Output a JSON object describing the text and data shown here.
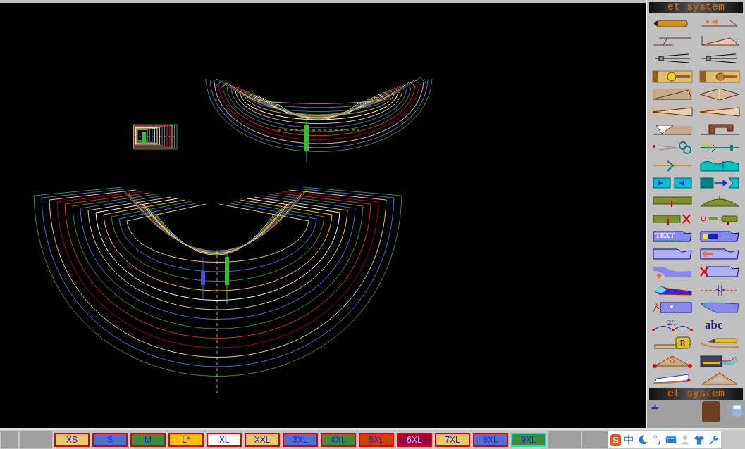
{
  "panel": {
    "header": "et system",
    "tools": [
      {
        "kind": "pencil"
      },
      {
        "kind": "arrow-line"
      },
      {
        "kind": "angle-line"
      },
      {
        "kind": "angle-wedge"
      },
      {
        "kind": "compass"
      },
      {
        "kind": "compass"
      },
      {
        "kind": "tape-button"
      },
      {
        "kind": "tape-slot"
      },
      {
        "kind": "open-dart"
      },
      {
        "kind": "diamond-dart"
      },
      {
        "kind": "long-dart"
      },
      {
        "kind": "long-dart"
      },
      {
        "kind": "pleat"
      },
      {
        "kind": "sewing-machine"
      },
      {
        "kind": "scissors"
      },
      {
        "kind": "feather-line"
      },
      {
        "kind": "cut-line"
      },
      {
        "kind": "wave-piece"
      },
      {
        "kind": "piece-arrow"
      },
      {
        "kind": "piece-arrow-right"
      },
      {
        "kind": "notch"
      },
      {
        "kind": "hill"
      },
      {
        "kind": "notch-delete"
      },
      {
        "kind": "drill"
      },
      {
        "kind": "text-piece",
        "text": "TEXT"
      },
      {
        "kind": "brush-piece"
      },
      {
        "kind": "piece"
      },
      {
        "kind": "piece-arrow-left"
      },
      {
        "kind": "piece-up"
      },
      {
        "kind": "piece-delete"
      },
      {
        "kind": "curved-piece"
      },
      {
        "kind": "dashed-line"
      },
      {
        "kind": "piece-sparkle"
      },
      {
        "kind": "piece-curve"
      },
      {
        "kind": "ratio-curve",
        "text": "2/1"
      },
      {
        "kind": "abc",
        "text": "abc"
      },
      {
        "kind": "measure-tape",
        "text": "R"
      },
      {
        "kind": "pencil-curve"
      },
      {
        "kind": "triangle-ruler"
      },
      {
        "kind": "calculator"
      },
      {
        "kind": "curve-ruler"
      },
      {
        "kind": "set-square"
      }
    ],
    "footer_header": "et system"
  },
  "sizes": [
    {
      "label": "XS",
      "color": "#e8cc6c",
      "selected": false
    },
    {
      "label": "S",
      "color": "#5070d0",
      "selected": false
    },
    {
      "label": "M",
      "color": "#3c8c3c",
      "selected": false
    },
    {
      "label": "L*",
      "color": "#ffc000",
      "selected": false
    },
    {
      "label": "XL",
      "color": "#ffffff",
      "selected": false
    },
    {
      "label": "XXL",
      "color": "#e8cc6c",
      "selected": false
    },
    {
      "label": "3XL",
      "color": "#5070d0",
      "selected": false
    },
    {
      "label": "4XL",
      "color": "#3c8c3c",
      "selected": false
    },
    {
      "label": "5XL",
      "color": "#d04000",
      "selected": false
    },
    {
      "label": "6XL",
      "color": "#a00040",
      "selected": false
    },
    {
      "label": "7XL",
      "color": "#e8cc6c",
      "selected": false
    },
    {
      "label": "8XL",
      "color": "#5070d0",
      "selected": false
    },
    {
      "label": "9XL",
      "color": "#3c8c3c",
      "selected": true
    }
  ],
  "tray": {
    "logo": "S",
    "language": "中"
  }
}
